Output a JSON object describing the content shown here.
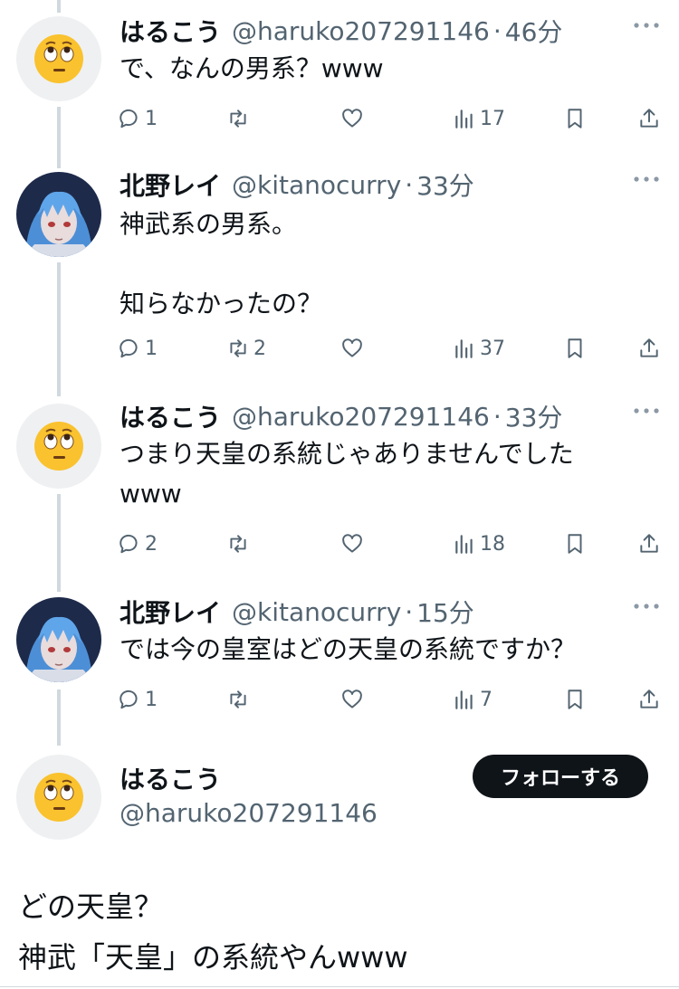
{
  "tweets": [
    {
      "name": "はるこう",
      "handle": "@haruko207291146",
      "time": "46分",
      "text": "で、なんの男系？www",
      "avatar": "face-with-rolling-eyes",
      "replies": "1",
      "reposts": "",
      "views": "17"
    },
    {
      "name": "北野レイ",
      "handle": "@kitanocurry",
      "time": "33分",
      "text": "神武系の男系。\n\n知らなかったの？",
      "avatar": "anime-blue-hair",
      "replies": "1",
      "reposts": "2",
      "views": "37"
    },
    {
      "name": "はるこう",
      "handle": "@haruko207291146",
      "time": "33分",
      "text": "つまり天皇の系統じゃありませんでした\nwww",
      "avatar": "face-with-rolling-eyes",
      "replies": "2",
      "reposts": "",
      "views": "18"
    },
    {
      "name": "北野レイ",
      "handle": "@kitanocurry",
      "time": "15分",
      "text": "では今の皇室はどの天皇の系統ですか？",
      "avatar": "anime-blue-hair",
      "replies": "1",
      "reposts": "",
      "views": "7"
    }
  ],
  "main_tweet": {
    "name": "はるこう",
    "handle": "@haruko207291146",
    "follow_label": "フォローする",
    "text": "どの天皇？\n神武「天皇」の系統やんwww",
    "avatar": "face-with-rolling-eyes"
  },
  "separator": "·",
  "colors": {
    "text": "#0f1419",
    "secondary": "#536471",
    "thread_line": "#cfd9de",
    "button_bg": "#0f1419"
  },
  "icons": [
    "reply-icon",
    "repost-icon",
    "like-icon",
    "views-icon",
    "bookmark-icon",
    "share-icon",
    "more-icon"
  ]
}
